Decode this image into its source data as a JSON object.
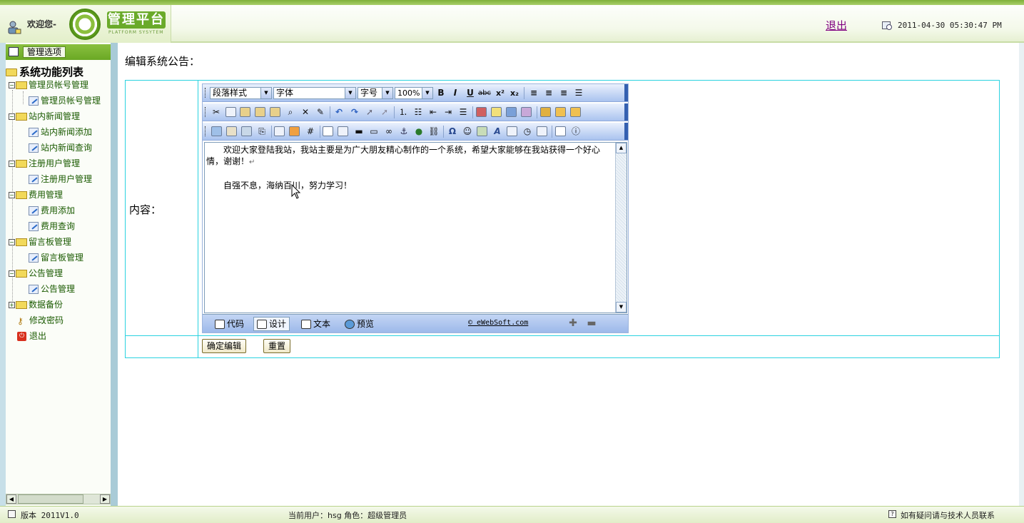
{
  "header": {
    "welcome": "欢迎您-",
    "logo_title": "管理平台",
    "logo_subtitle": "PLATFORM SYSYTEM",
    "logout": "退出",
    "datetime": "2011-04-30 05:30:47 PM"
  },
  "sidebar": {
    "menu_button": "管理选项",
    "tree_title": "系统功能列表",
    "groups": [
      {
        "label": "管理员帐号管理",
        "children": [
          "管理员帐号管理"
        ]
      },
      {
        "label": "站内新闻管理",
        "children": [
          "站内新闻添加",
          "站内新闻查询"
        ]
      },
      {
        "label": "注册用户管理",
        "children": [
          "注册用户管理"
        ]
      },
      {
        "label": "费用管理",
        "children": [
          "费用添加",
          "费用查询"
        ]
      },
      {
        "label": "留言板管理",
        "children": [
          "留言板管理"
        ]
      },
      {
        "label": "公告管理",
        "children": [
          "公告管理"
        ]
      },
      {
        "label": "数据备份",
        "children": []
      }
    ],
    "extra_items": [
      "修改密码",
      "退出"
    ]
  },
  "main": {
    "page_title": "编辑系统公告：",
    "content_label": "内容：",
    "editor": {
      "paragraph_style": "段落样式",
      "font_name": "字体",
      "font_size": "字号",
      "zoom": "100%",
      "text_line1": "欢迎大家登陆我站，我站主要是为广大朋友精心制作的一个系统，希望大家能够在我站获得一个好心",
      "text_line2": "情，谢谢！",
      "text_line3": "自强不息，海纳百川，努力学习！",
      "mode_tabs": [
        "代码",
        "设计",
        "文本",
        "预览"
      ],
      "active_mode": "设计",
      "copyright": "© eWebSoft.com"
    },
    "buttons": {
      "submit": "确定编辑",
      "reset": "重置"
    }
  },
  "footer": {
    "version": "版本 2011V1.0",
    "current_user": "当前用户：hsg  角色：超级管理员",
    "help": "如有疑问请与技术人员联系"
  }
}
